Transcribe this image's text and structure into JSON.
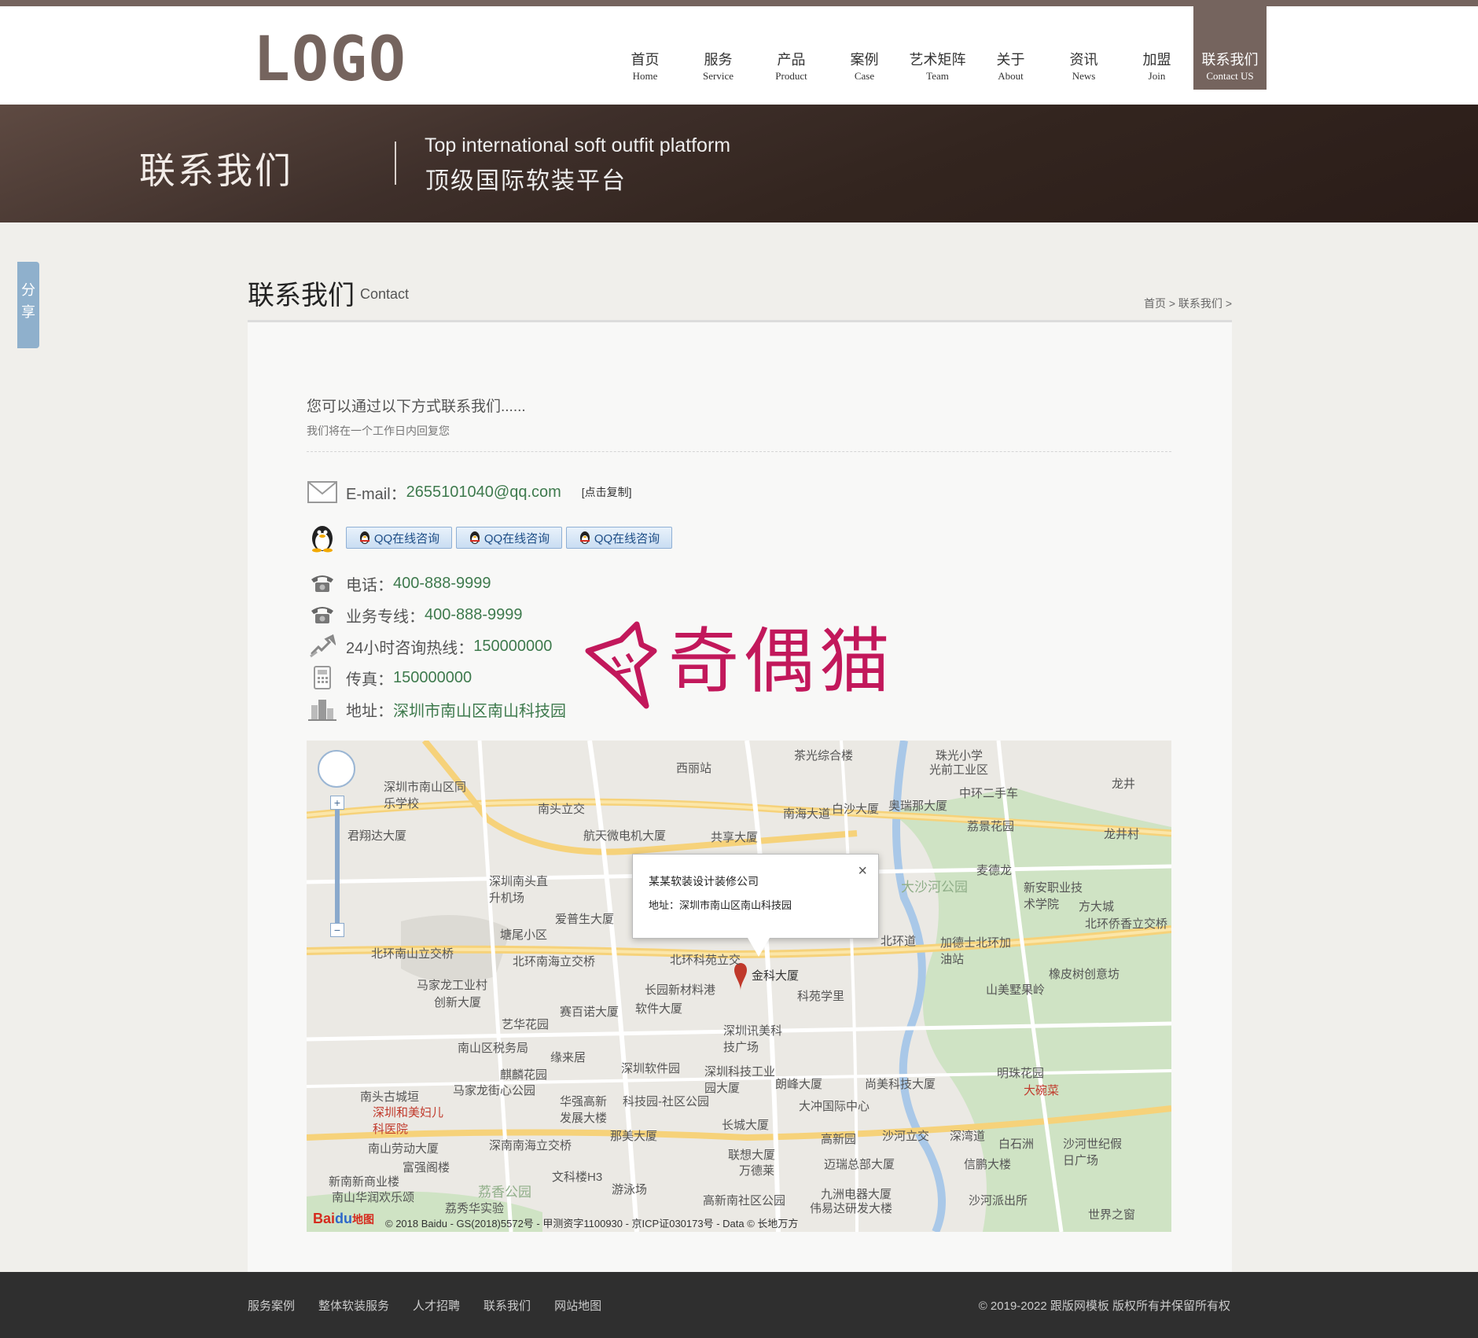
{
  "header": {
    "logo": "LOGO",
    "nav": [
      {
        "cn": "首页",
        "en": "Home"
      },
      {
        "cn": "服务",
        "en": "Service"
      },
      {
        "cn": "产品",
        "en": "Product"
      },
      {
        "cn": "案例",
        "en": "Case"
      },
      {
        "cn": "艺术矩阵",
        "en": "Team"
      },
      {
        "cn": "关于",
        "en": "About"
      },
      {
        "cn": "资讯",
        "en": "News"
      },
      {
        "cn": "加盟",
        "en": "Join"
      },
      {
        "cn": "联系我们",
        "en": "Contact US"
      }
    ],
    "active_index": 8
  },
  "banner": {
    "title": "联系我们",
    "en": "Top international soft outfit platform",
    "cn": "顶级国际软装平台"
  },
  "share": {
    "label": "分享"
  },
  "section": {
    "title": "联系我们",
    "subtitle": "Contact",
    "breadcrumb": "首页 > 联系我们 >"
  },
  "contact": {
    "intro": "您可以通过以下方式联系我们......",
    "intro_sub": "我们将在一个工作日内回复您",
    "email_label": "E-mail：",
    "email": "2655101040@qq.com",
    "copy_label": "[点击复制]",
    "qq_buttons": [
      "QQ在线咨询",
      "QQ在线咨询",
      "QQ在线咨询"
    ],
    "phone_label": "电话：",
    "phone": "400-888-9999",
    "biz_label": "业务专线：",
    "biz": "400-888-9999",
    "hotline_label": "24小时咨询热线：",
    "hotline": "150000000",
    "fax_label": "传真：",
    "fax": "150000000",
    "addr_label": "地址：",
    "addr": "深圳市南山区南山科技园"
  },
  "watermark": {
    "text": "奇偶猫"
  },
  "map": {
    "popup_name": "某某软装设计装修公司",
    "popup_addr": "地址：深圳市南山区南山科技园",
    "close": "×",
    "copyright": "© 2018 Baidu - GS(2018)5572号 - 甲测资字1100930 - 京ICP证030173号 - Data © 长地万方",
    "baidu": "Bai",
    "baidu2": "du",
    "baidu3": "地图",
    "labels": [
      "西丽站",
      "茶光综合楼",
      "珠光小学",
      "光前工业区",
      "龙井",
      "南头立交",
      "南海大道",
      "白沙大厦",
      "奥瑞那大厦",
      "中环二手车",
      "荔景花园",
      "龙井村",
      "深圳市南山区同乐学校",
      "君翔达大厦",
      "航天微电机大厦",
      "共享大厦",
      "深圳南头直升机场",
      "爱普生大厦",
      "塘尾小区",
      "北环南山立交桥",
      "北环南海立交桥",
      "北环科苑立交",
      "金科大厦",
      "大沙河公园",
      "北环道",
      "加德士北环加油站",
      "麦德龙",
      "新安职业技术学院",
      "方大城",
      "北环侨香立交桥",
      "马家龙工业村",
      "创新大厦",
      "长园新材料港",
      "科苑学里",
      "山美墅果岭",
      "橡皮树创意坊",
      "赛百诺大厦",
      "软件大厦",
      "深圳讯美科技广场",
      "南山区税务局",
      "艺华花园",
      "缘来居",
      "深圳软件园",
      "麒麟花园",
      "马家龙街心公园",
      "深圳科技工业园大厦",
      "朗峰大厦",
      "尚美科技大厦",
      "明珠花园",
      "大碗菜",
      "南头古城垣",
      "深圳和美妇儿科医院",
      "华强高新发展大楼",
      "科技园-社区公园",
      "大冲国际中心",
      "长城大厦",
      "高新园",
      "沙河立交",
      "深湾道",
      "白石洲",
      "南山劳动大厦",
      "深南南海立交桥",
      "那美大厦",
      "联想大厦",
      "万德莱",
      "迈瑞总部大厦",
      "信鹏大楼",
      "沙河世纪假日广场",
      "富强阁楼",
      "荔香公园",
      "文科楼H3",
      "游泳场",
      "高新南社区公园",
      "九洲电器大厦",
      "伟易达研发大楼",
      "沙河派出所",
      "世界之窗",
      "新南新商业楼",
      "南山华润欢乐颂",
      "荔秀华实验"
    ]
  },
  "footer": {
    "links": [
      "服务案例",
      "整体软装服务",
      "人才招聘",
      "联系我们",
      "网站地图"
    ],
    "copyright": "© 2019-2022 跟版网模板 版权所有并保留所有权"
  },
  "colors": {
    "brand": "#75645e",
    "value": "#3e7a4d",
    "footer": "#2f2f2f"
  }
}
